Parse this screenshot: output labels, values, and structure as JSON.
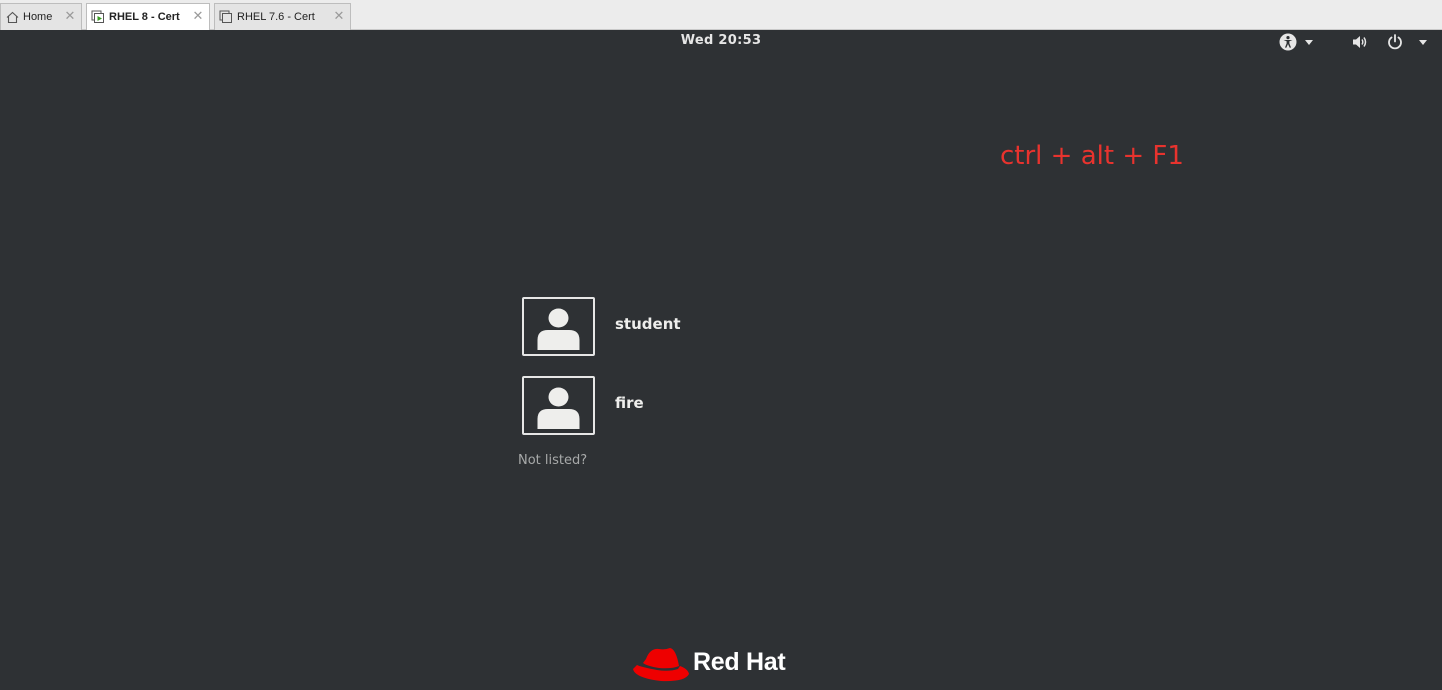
{
  "tabs": [
    {
      "label": "Home",
      "icon": "home-icon",
      "active": false
    },
    {
      "label": "RHEL 8 - Cert",
      "icon": "vm-running-icon",
      "active": true
    },
    {
      "label": "RHEL 7.6  - Cert",
      "icon": "vm-icon",
      "active": false
    }
  ],
  "topbar": {
    "clock": "Wed 20:53",
    "icons": [
      "accessibility-icon",
      "volume-icon",
      "power-icon"
    ]
  },
  "annotation": "ctrl + alt + F1",
  "users": [
    {
      "name": "student"
    },
    {
      "name": "fire"
    }
  ],
  "not_listed": "Not listed?",
  "brand": {
    "name": "Red Hat",
    "color": "#ee0000"
  },
  "colors": {
    "background": "#2e3134",
    "annotation": "#e8332e"
  }
}
